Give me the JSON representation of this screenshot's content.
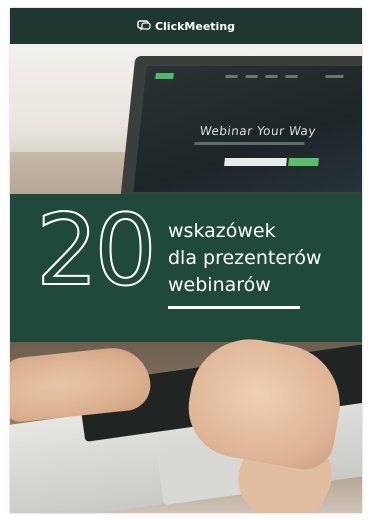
{
  "brand": {
    "name": "ClickMeeting",
    "icon": "chat-bubble-icon"
  },
  "screen": {
    "headline": "Webinar Your Way"
  },
  "title": {
    "number": "20",
    "lines": [
      "wskazówek",
      "dla prezenterów",
      "webinarów"
    ]
  },
  "colors": {
    "brand_bar": "#1f3731",
    "title_band": "#1f4a3b",
    "accent_green": "#57c06a",
    "text": "#ffffff"
  }
}
